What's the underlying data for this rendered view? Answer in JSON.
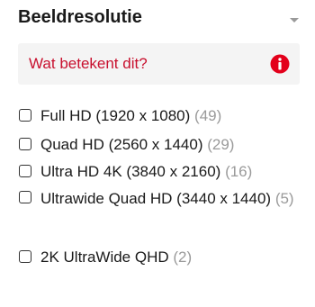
{
  "filter": {
    "title": "Beeldresolutie",
    "info_label": "Wat betekent dit?",
    "colors": {
      "info_text": "#c8102e",
      "info_icon": "#e3001b",
      "count": "#9a9a9a"
    },
    "options": [
      {
        "label": "Full HD (1920 x 1080)",
        "count": "(49)",
        "checked": false
      },
      {
        "label": "Quad HD (2560 x 1440)",
        "count": "(29)",
        "checked": false
      },
      {
        "label": "Ultra HD 4K (3840 x 2160)",
        "count": "(16)",
        "checked": false
      },
      {
        "label": "Ultrawide Quad HD (3440 x 1440)",
        "count": "(5)",
        "checked": false
      },
      {
        "label": "2K UltraWide QHD",
        "count": "(2)",
        "checked": false
      }
    ]
  }
}
